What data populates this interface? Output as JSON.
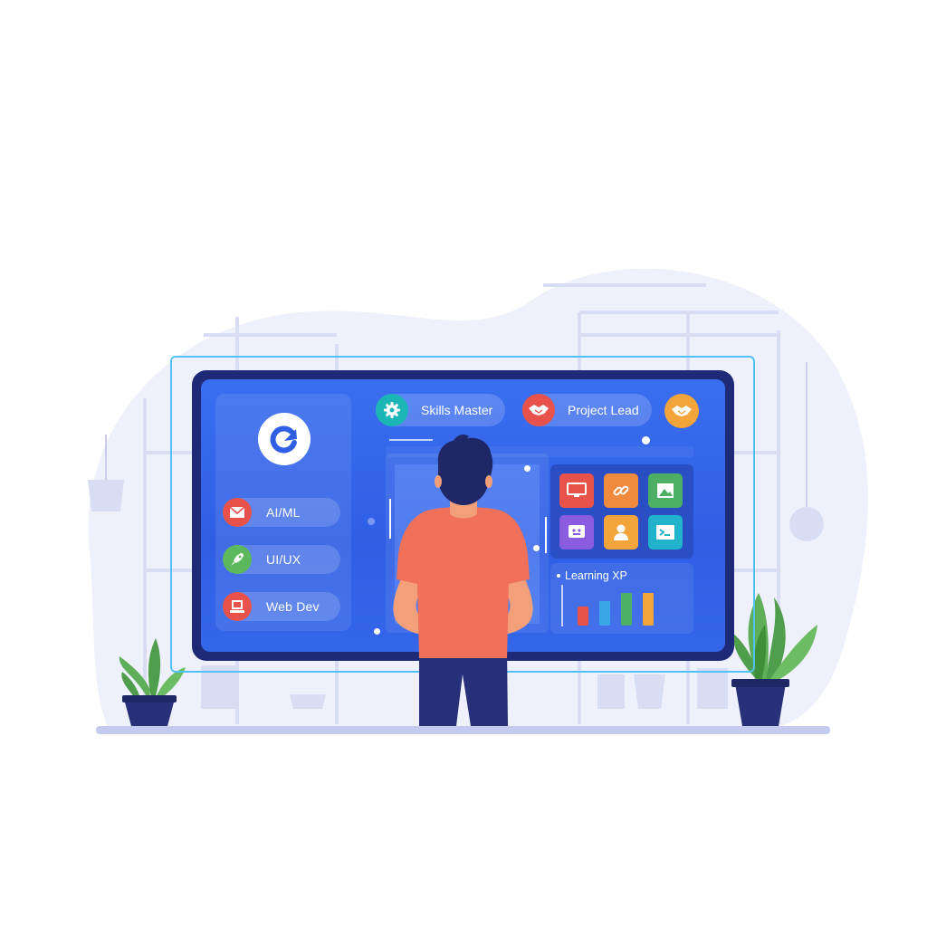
{
  "courses": [
    {
      "label": "AI/ML",
      "icon": "mail-icon",
      "color": "#e8524a"
    },
    {
      "label": "UI/UX",
      "icon": "rocket-icon",
      "color": "#5cb85c"
    },
    {
      "label": "Web Dev",
      "icon": "laptop-icon",
      "color": "#e8524a"
    }
  ],
  "badges": [
    {
      "label": "Skills Master",
      "icon": "gear-icon",
      "color": "#1cb5b5"
    },
    {
      "label": "Project Lead",
      "icon": "handshake-icon",
      "color": "#e8524a"
    }
  ],
  "extra_badge": {
    "icon": "handshake-icon",
    "color": "#f3a43a"
  },
  "logo": {
    "icon": "refresh-arrow-icon",
    "color": "#2f5ee4"
  },
  "apps": [
    {
      "icon": "monitor-icon",
      "color": "#e8524a"
    },
    {
      "icon": "link-icon",
      "color": "#f08a3c"
    },
    {
      "icon": "image-icon",
      "color": "#4caf63"
    },
    {
      "icon": "face-icon",
      "color": "#8a5ce0"
    },
    {
      "icon": "person-icon",
      "color": "#f3a43a"
    },
    {
      "icon": "terminal-icon",
      "color": "#22b3cc"
    }
  ],
  "xp": {
    "label": "Learning XP",
    "bars": [
      {
        "value": 0.35,
        "color": "#e8524a"
      },
      {
        "value": 0.45,
        "color": "#3aa6e8"
      },
      {
        "value": 0.6,
        "color": "#4caf63"
      },
      {
        "value": 0.6,
        "color": "#f3a43a"
      }
    ]
  }
}
